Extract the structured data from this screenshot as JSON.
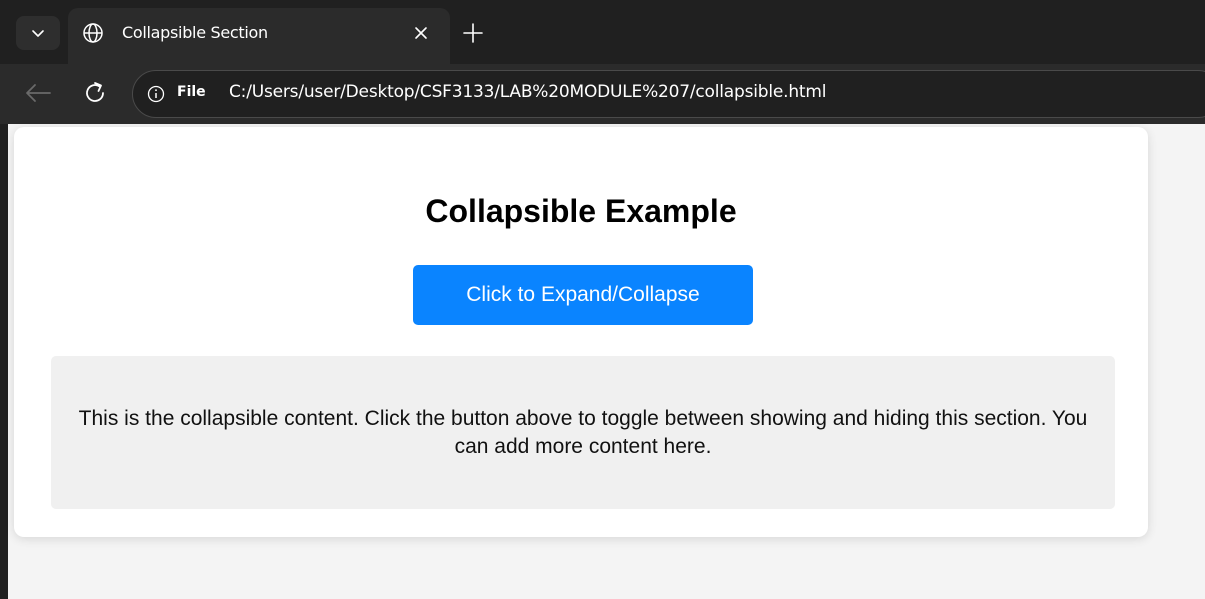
{
  "browser": {
    "tab": {
      "title": "Collapsible Section"
    },
    "address_bar": {
      "scheme_label": "File",
      "url": "C:/Users/user/Desktop/CSF3133/LAB%20MODULE%207/collapsible.html"
    },
    "icons": [
      "tab-search-icon",
      "globe-icon",
      "close-icon",
      "plus-icon",
      "back-arrow-icon",
      "reload-icon",
      "info-icon"
    ]
  },
  "page": {
    "heading": "Collapsible Example",
    "toggle_button_label": "Click to Expand/Collapse",
    "content": "This is the collapsible content. Click the button above to toggle between showing and hiding this section. You can add more content here."
  },
  "colors": {
    "button": "#0a84ff",
    "content_background": "#f0f0f0",
    "page_background": "#f4f4f4",
    "browser_chrome": "#202020"
  }
}
